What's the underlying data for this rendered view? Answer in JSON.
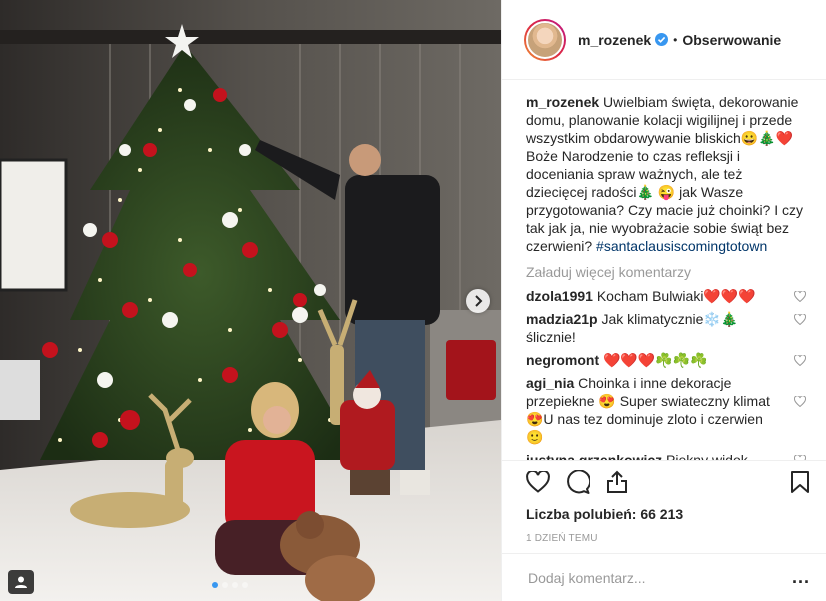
{
  "post": {
    "username": "m_rozenek",
    "follow_label": "Obserwowanie",
    "caption_user": "m_rozenek",
    "caption_text": "Uwielbiam święta, dekorowanie domu, planowanie kolacji wigilijnej i przede wszystkim obdarowywanie bliskich😀🎄❤️ Boże Narodzenie to czas refleksji i doceniania spraw ważnych, ale też dziecięcej radości🎄 😜 jak Wasze przygotowania? Czy macie już choinki? I czy tak jak ja, nie wyobrażacie sobie świąt bez czerwieni? ",
    "hashtag": "#santaclausiscomingtotown",
    "load_more": "Załaduj więcej komentarzy",
    "likes_label": "Liczba polubień: 66 213",
    "time_ago": "1 dzień temu",
    "comment_placeholder": "Dodaj komentarz...",
    "more_label": "..."
  },
  "comments": [
    {
      "user": "dzola1991",
      "text": "Kocham Bulwiaki❤️❤️❤️"
    },
    {
      "user": "madzia21p",
      "text": "Jak klimatycznie❄️🎄ślicznie!"
    },
    {
      "user": "negromont",
      "text": "❤️❤️❤️☘️☘️☘️"
    },
    {
      "user": "agi_nia",
      "text": "Choinka i inne dekoracje przepiekne 😍 Super swiateczny klimat 😍U nas tez dominuje zloto i czerwien 🙂"
    },
    {
      "user": "justyna.grzenkowicz",
      "text": "Piękny widok."
    }
  ],
  "icons": {
    "verified": "verified-badge-icon",
    "like": "heart-icon",
    "comment": "comment-bubble-icon",
    "share": "share-icon",
    "save": "bookmark-icon",
    "next": "chevron-right-icon",
    "tag": "user-tag-icon"
  },
  "colors": {
    "verified_blue": "#3897f0",
    "hashtag": "#003569",
    "muted": "#999999",
    "text": "#262626",
    "active_dot": "#3897f0"
  },
  "carousel": {
    "slides": 4,
    "active": 1
  }
}
